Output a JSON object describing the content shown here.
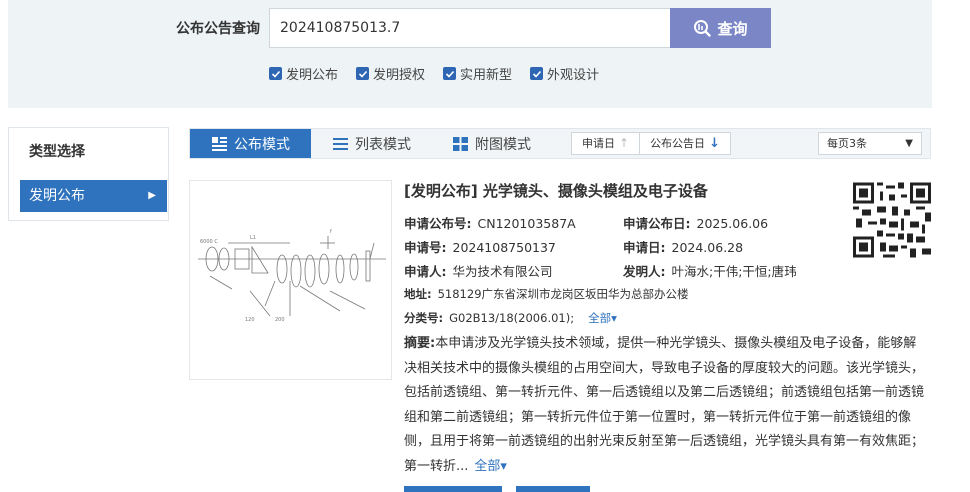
{
  "search": {
    "label": "公布公告查询",
    "value": "202410875013.7",
    "button_label": "查询"
  },
  "filters": [
    {
      "label": "发明公布",
      "checked": true
    },
    {
      "label": "发明授权",
      "checked": true
    },
    {
      "label": "实用新型",
      "checked": true
    },
    {
      "label": "外观设计",
      "checked": true
    }
  ],
  "sidebar": {
    "title": "类型选择",
    "items": [
      {
        "label": "发明公布",
        "selected": true
      }
    ]
  },
  "toolbar": {
    "modes": [
      {
        "label": "公布模式",
        "active": true,
        "icon": "list-lines-icon"
      },
      {
        "label": "列表模式",
        "active": false,
        "icon": "list-icon"
      },
      {
        "label": "附图模式",
        "active": false,
        "icon": "grid-icon"
      }
    ],
    "sort": [
      {
        "label": "申请日",
        "arrow": "↑"
      },
      {
        "label": "公布公告日",
        "arrow": "↓"
      }
    ],
    "per_page": "每页3条"
  },
  "result": {
    "title": "[发明公布] 光学镜头、摄像头模组及电子设备",
    "pub_no_label": "申请公布号:",
    "pub_no": "CN120103587A",
    "pub_date_label": "申请公布日:",
    "pub_date": "2025.06.06",
    "app_no_label": "申请号:",
    "app_no": "2024108750137",
    "app_date_label": "申请日:",
    "app_date": "2024.06.28",
    "applicant_label": "申请人:",
    "applicant": "华为技术有限公司",
    "inventor_label": "发明人:",
    "inventor": "叶海水;干伟;干恒;唐玮",
    "address_label": "地址:",
    "address": "518129广东省深圳市龙岗区坂田华为总部办公楼",
    "class_label": "分类号:",
    "class_no": "G02B13/18(2006.01);",
    "class_expand": "全部▾",
    "abstract_label": "摘要:",
    "abstract_text": "本申请涉及光学镜头技术领域，提供一种光学镜头、摄像头模组及电子设备，能够解决相关技术中的摄像头模组的占用空间大，导致电子设备的厚度较大的问题。该光学镜头，包括前透镜组、第一转折元件、第一后透镜组以及第二后透镜组；前透镜组包括第一前透镜组和第二前透镜组；第一转折元件位于第一位置时，第一转折元件位于第一前透镜组的像侧，且用于将第一前透镜组的出射光束反射至第一后透镜组，光学镜头具有第一有效焦距；第一转折...",
    "abstract_expand": "全部▾"
  },
  "colors": {
    "primary": "#2f72bd",
    "search_button": "#7a86c6",
    "band": "#eef4f6"
  }
}
